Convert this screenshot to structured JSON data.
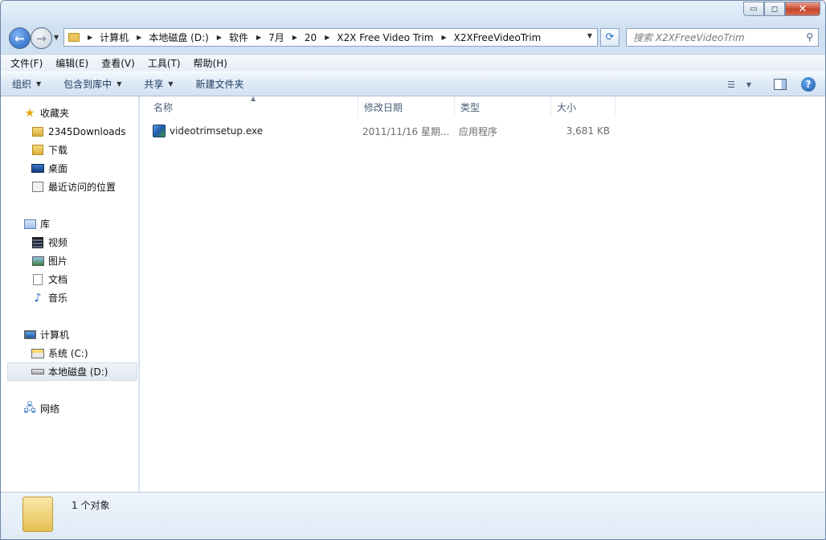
{
  "window": {
    "caption": {
      "minimize": "▭",
      "maximize": "◻",
      "close": "✕"
    }
  },
  "address": {
    "crumbs": [
      "计算机",
      "本地磁盘 (D:)",
      "软件",
      "7月",
      "20",
      "X2X Free Video Trim",
      "X2XFreeVideoTrim"
    ]
  },
  "search": {
    "placeholder": "搜索 X2XFreeVideoTrim"
  },
  "menu": [
    "文件(F)",
    "编辑(E)",
    "查看(V)",
    "工具(T)",
    "帮助(H)"
  ],
  "toolbar": {
    "organize": "组织",
    "include_in_library": "包含到库中",
    "share": "共享",
    "new_folder": "新建文件夹"
  },
  "navpane": {
    "favorites": {
      "label": "收藏夹",
      "items": [
        "2345Downloads",
        "下载",
        "桌面",
        "最近访问的位置"
      ]
    },
    "libraries": {
      "label": "库",
      "items": [
        "视频",
        "图片",
        "文档",
        "音乐"
      ]
    },
    "computer": {
      "label": "计算机",
      "items": [
        "系统 (C:)",
        "本地磁盘 (D:)"
      ],
      "selected": "本地磁盘 (D:)"
    },
    "network": {
      "label": "网络"
    }
  },
  "columns": [
    "名称",
    "修改日期",
    "类型",
    "大小"
  ],
  "files": [
    {
      "name": "videotrimsetup.exe",
      "modified": "2011/11/16 星期...",
      "type": "应用程序",
      "size": "3,681 KB"
    }
  ],
  "status": {
    "text": "1 个对象"
  },
  "colors": {
    "window_frame": "#cfe0f1",
    "accent": "#1e5fb8"
  }
}
